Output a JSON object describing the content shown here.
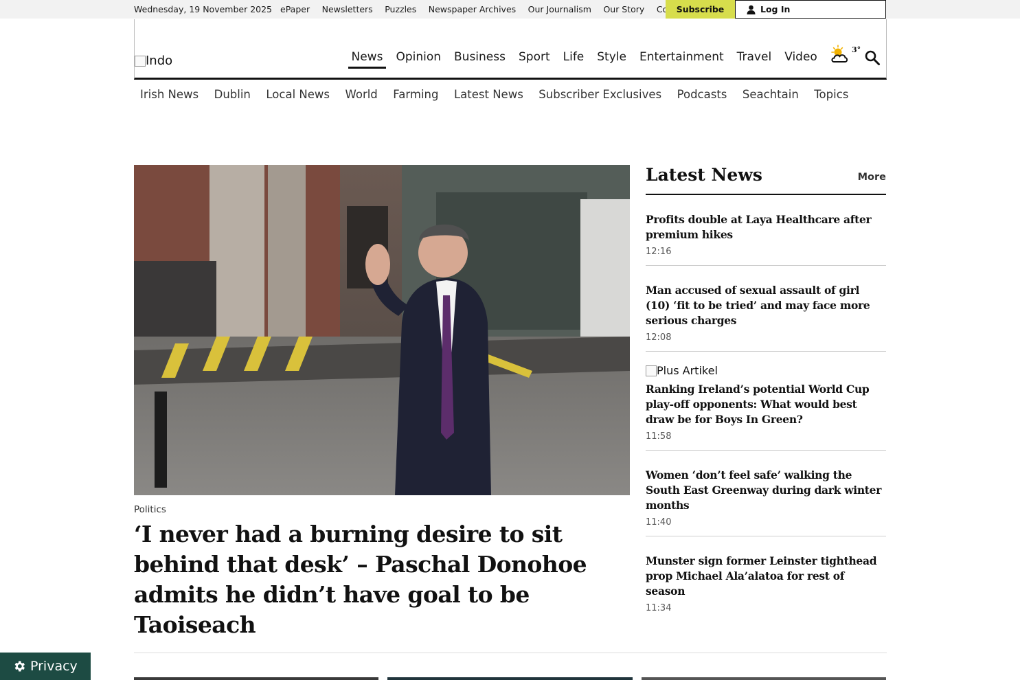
{
  "topbar": {
    "date": "Wednesday, 19 November 2025",
    "links": [
      "ePaper",
      "Newsletters",
      "Puzzles",
      "Newspaper Archives",
      "Our Journalism",
      "Our Story",
      "Contact Us"
    ],
    "subscribe_label": "Subscribe",
    "login_label": "Log In"
  },
  "masthead": {
    "logo_alt": "Indo",
    "nav": [
      "News",
      "Opinion",
      "Business",
      "Sport",
      "Life",
      "Style",
      "Entertainment",
      "Travel",
      "Video"
    ],
    "active_nav": "News",
    "weather_temp": "3°",
    "weather_icon": "partly-cloudy-icon"
  },
  "subnav": [
    "Irish News",
    "Dublin",
    "Local News",
    "World",
    "Farming",
    "Latest News",
    "Subscriber Exclusives",
    "Podcasts",
    "Seachtain",
    "Topics"
  ],
  "hero": {
    "category": "Politics",
    "headline": "‘I never had a burning desire to sit behind that desk’ – Paschal Donohoe admits he didn’t have goal to be Taoiseach"
  },
  "latest": {
    "title": "Latest News",
    "more_label": "More",
    "items": [
      {
        "headline": "Profits double at Laya Healthcare after premium hikes",
        "time": "12:16",
        "plus": ""
      },
      {
        "headline": "Man accused of sexual assault of girl (10) ‘fit to be tried’ and may face more serious charges",
        "time": "12:08",
        "plus": ""
      },
      {
        "headline": "Ranking Ireland’s potential World Cup play-off opponents: What would best draw be for Boys In Green?",
        "time": "11:58",
        "plus": "Plus Artikel"
      },
      {
        "headline": "Women ‘don’t feel safe’ walking the South East Greenway during dark winter months",
        "time": "11:40",
        "plus": ""
      },
      {
        "headline": "Munster sign former Leinster tighthead prop Michael Ala’alatoa for rest of season",
        "time": "11:34",
        "plus": ""
      }
    ]
  },
  "privacy": {
    "label": "Privacy"
  },
  "colors": {
    "subscribe_bg": "#d7dd4c",
    "privacy_bg": "#1d4b43",
    "topbar_bg": "#f2f2f2"
  }
}
